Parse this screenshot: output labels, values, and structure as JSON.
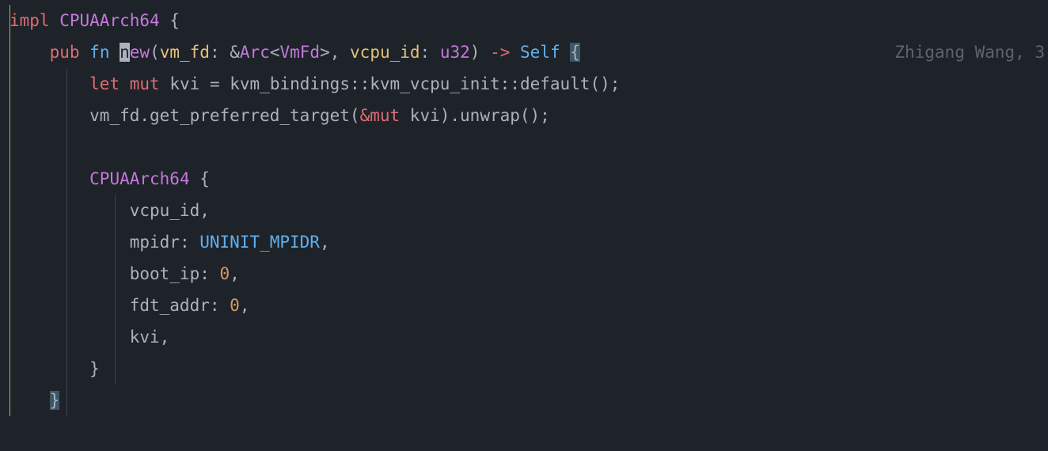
{
  "code": {
    "l1": {
      "impl": "impl",
      "type": "CPUAArch64",
      "brace": "{"
    },
    "l2": {
      "pub": "pub",
      "fn": "fn",
      "name_n": "n",
      "name_rest": "ew",
      "p1": "vm_fd",
      "p1_ref": "&",
      "p1_type": "Arc",
      "p1_lt": "<",
      "p1_inner": "VmFd",
      "p1_gt": ">",
      "p2": "vcpu_id",
      "p2_type": "u32",
      "arrow": "->",
      "ret": "Self",
      "brace": "{",
      "blame": "Zhigang Wang, 3"
    },
    "l3": {
      "let": "let",
      "mut": "mut",
      "var": "kvi",
      "eq": "=",
      "mod1": "kvm_bindings",
      "mod2": "kvm_vcpu_init",
      "fn": "default",
      "call": "();"
    },
    "l4": {
      "var": "vm_fd",
      "method": "get_preferred_target",
      "refmut": "&mut",
      "arg": "kvi",
      "unwrap": "unwrap",
      "end": "();"
    },
    "l6": {
      "type": "CPUAArch64",
      "brace": "{"
    },
    "l7": {
      "field": "vcpu_id",
      "comma": ","
    },
    "l8": {
      "field": "mpidr",
      "val": "UNINIT_MPIDR",
      "comma": ","
    },
    "l9": {
      "field": "boot_ip",
      "val": "0",
      "comma": ","
    },
    "l10": {
      "field": "fdt_addr",
      "val": "0",
      "comma": ","
    },
    "l11": {
      "field": "kvi",
      "comma": ","
    },
    "l12": {
      "brace": "}"
    },
    "l13": {
      "brace": "}"
    }
  }
}
